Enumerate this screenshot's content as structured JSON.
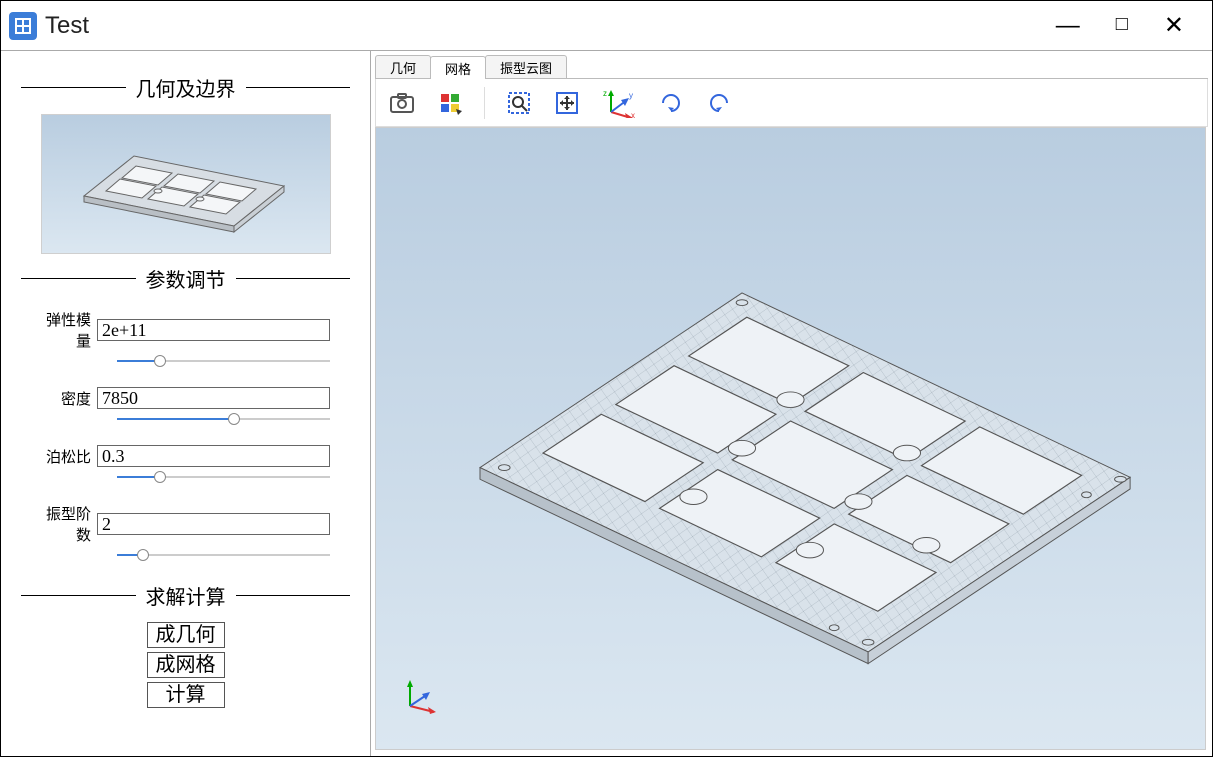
{
  "window": {
    "title": "Test"
  },
  "sidebar": {
    "section_geometry_boundary": "几何及边界",
    "section_parameters": "参数调节",
    "section_solve": "求解计算",
    "params": {
      "elastic_modulus": {
        "label": "弹性模量",
        "value": "2e+11",
        "slider_pct": 20
      },
      "density": {
        "label": "密度",
        "value": "7850",
        "slider_pct": 55
      },
      "poisson": {
        "label": "泊松比",
        "value": "0.3",
        "slider_pct": 20
      },
      "modes": {
        "label": "振型阶数",
        "value": "2",
        "slider_pct": 12
      }
    },
    "actions": {
      "gen_geometry": "成几何",
      "gen_mesh": "成网格",
      "compute": "计算"
    }
  },
  "tabs": {
    "geometry": "几何",
    "mesh": "网格",
    "mode_shape": "振型云图"
  },
  "toolbar_icons": {
    "screenshot": "screenshot-icon",
    "selection": "selection-icon",
    "zoom_box": "zoom-box-icon",
    "zoom_fit": "zoom-fit-icon",
    "axes": "axes-icon",
    "rotate_cw": "rotate-cw-icon",
    "rotate_ccw": "rotate-ccw-icon"
  }
}
